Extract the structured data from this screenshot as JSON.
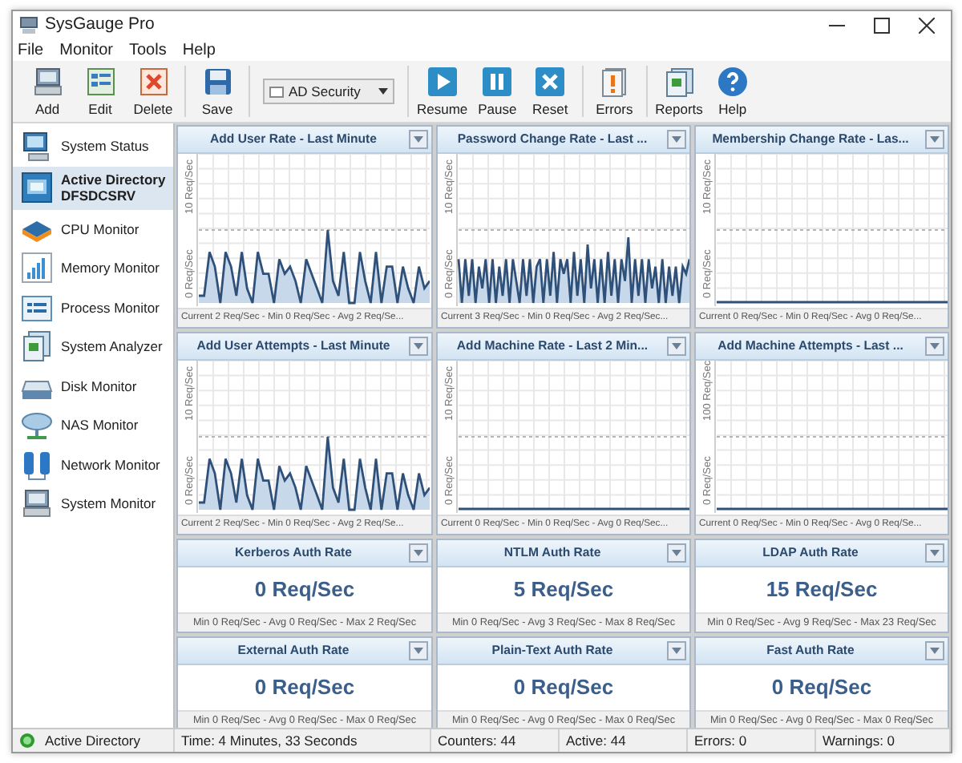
{
  "window": {
    "title": "SysGauge Pro"
  },
  "menu": [
    "File",
    "Monitor",
    "Tools",
    "Help"
  ],
  "toolbar": {
    "groups": [
      {
        "buttons": [
          {
            "label": "Add"
          },
          {
            "label": "Edit"
          },
          {
            "label": "Delete"
          }
        ]
      },
      {
        "buttons": [
          {
            "label": "Save"
          }
        ]
      },
      {
        "dropdown": {
          "value": "AD Security"
        }
      },
      {
        "buttons": [
          {
            "label": "Resume"
          },
          {
            "label": "Pause"
          },
          {
            "label": "Reset"
          }
        ]
      },
      {
        "buttons": [
          {
            "label": "Errors"
          }
        ]
      },
      {
        "buttons": [
          {
            "label": "Reports"
          },
          {
            "label": "Help"
          }
        ]
      }
    ]
  },
  "sidebar": {
    "items": [
      {
        "label": "System Status",
        "selected": false
      },
      {
        "label": "Active Directory",
        "sublabel": "DFSDCSRV",
        "selected": true
      },
      {
        "label": "CPU Monitor",
        "selected": false
      },
      {
        "label": "Memory Monitor",
        "selected": false
      },
      {
        "label": "Process Monitor",
        "selected": false
      },
      {
        "label": "System Analyzer",
        "selected": false
      },
      {
        "label": "Disk Monitor",
        "selected": false
      },
      {
        "label": "NAS Monitor",
        "selected": false
      },
      {
        "label": "Network Monitor",
        "selected": false
      },
      {
        "label": "System Monitor",
        "selected": false
      }
    ]
  },
  "panels": [
    {
      "kind": "chart",
      "title": "Add User Rate - Last Minute",
      "axis_labels": [
        "10 Req/Sec",
        "0 Req/Sec"
      ],
      "graph": {
        "kind": "spikes"
      },
      "footer": "Current 2 Req/Sec - Min 0 Req/Sec - Avg 2 Req/Se..."
    },
    {
      "kind": "chart",
      "title": "Password Change Rate - Last ...",
      "axis_labels": [
        "10 Req/Sec",
        "0 Req/Sec"
      ],
      "graph": {
        "kind": "dense"
      },
      "footer": "Current 3 Req/Sec - Min 0 Req/Sec - Avg 2 Req/Sec..."
    },
    {
      "kind": "chart",
      "title": "Membership Change Rate - Las...",
      "axis_labels": [
        "10 Req/Sec",
        "0 Req/Sec"
      ],
      "graph": {
        "kind": "flat"
      },
      "footer": "Current 0 Req/Sec - Min 0 Req/Sec - Avg 0 Req/Se..."
    },
    {
      "kind": "chart",
      "title": "Add User Attempts - Last Minute",
      "axis_labels": [
        "10 Req/Sec",
        "0 Req/Sec"
      ],
      "graph": {
        "kind": "spikes"
      },
      "footer": "Current 2 Req/Sec - Min 0 Req/Sec - Avg 2 Req/Se..."
    },
    {
      "kind": "chart",
      "title": "Add Machine Rate - Last 2 Min...",
      "axis_labels": [
        "10 Req/Sec",
        "0 Req/Sec"
      ],
      "graph": {
        "kind": "flat"
      },
      "footer": "Current 0 Req/Sec - Min 0 Req/Sec - Avg 0 Req/Sec..."
    },
    {
      "kind": "chart",
      "title": "Add Machine Attempts - Last ...",
      "axis_labels": [
        "100 Req/Sec",
        "0 Req/Sec"
      ],
      "graph": {
        "kind": "flat"
      },
      "footer": "Current 0 Req/Sec - Min 0 Req/Sec - Avg 0 Req/Se..."
    },
    {
      "kind": "value",
      "title": "Kerberos Auth Rate",
      "value": "0 Req/Sec",
      "footer": "Min 0 Req/Sec - Avg 0 Req/Sec - Max 2 Req/Sec"
    },
    {
      "kind": "value",
      "title": "NTLM Auth Rate",
      "value": "5 Req/Sec",
      "footer": "Min 0 Req/Sec - Avg 3 Req/Sec - Max 8 Req/Sec"
    },
    {
      "kind": "value",
      "title": "LDAP Auth Rate",
      "value": "15 Req/Sec",
      "footer": "Min 0 Req/Sec - Avg 9 Req/Sec - Max 23 Req/Sec"
    },
    {
      "kind": "value",
      "title": "External Auth Rate",
      "value": "0 Req/Sec",
      "footer": "Min 0 Req/Sec - Avg 0 Req/Sec - Max 0 Req/Sec"
    },
    {
      "kind": "value",
      "title": "Plain-Text Auth Rate",
      "value": "0 Req/Sec",
      "footer": "Min 0 Req/Sec - Avg 0 Req/Sec - Max 0 Req/Sec"
    },
    {
      "kind": "value",
      "title": "Fast Auth Rate",
      "value": "0 Req/Sec",
      "footer": "Min 0 Req/Sec - Avg 0 Req/Sec - Max 0 Req/Sec"
    }
  ],
  "status_bar": {
    "module": "Active Directory",
    "fields": [
      "Time: 4 Minutes, 33 Seconds",
      "Counters: 44",
      "Active: 44",
      "Errors: 0",
      "Warnings: 0"
    ]
  }
}
